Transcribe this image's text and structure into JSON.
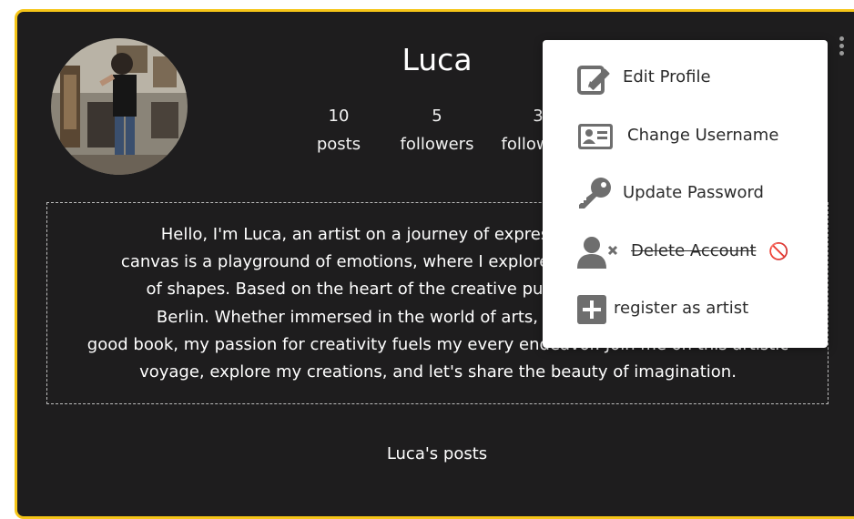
{
  "profile": {
    "name": "Luca",
    "stats": [
      {
        "value": "10",
        "label": "posts"
      },
      {
        "value": "5",
        "label": "followers"
      },
      {
        "value": "3",
        "label": "following"
      }
    ],
    "bio": "Hello, I'm Luca, an artist on a journey of expression through art. My\ncanvas is a playground of emotions, where I explore the beauty of colors and\nof shapes. Based on the heart of the creative pulse, I find inspiration in\nBerlin. Whether immersed in the world of arts, sketching, or lost in a\ngood book, my passion for creativity fuels my every endeavor. Join me on this artistic\nvoyage, explore my creations, and let's share the beauty of imagination.",
    "posts_title": "Luca's posts"
  },
  "menu": {
    "items": [
      {
        "label": "Edit Profile",
        "icon": "edit-icon"
      },
      {
        "label": "Change Username",
        "icon": "id-card-icon"
      },
      {
        "label": "Update Password",
        "icon": "key-icon"
      },
      {
        "label": "Delete Account",
        "icon": "user-remove-icon",
        "suffix": "🚫",
        "disabled": true
      },
      {
        "label": "register as artist",
        "icon": "plus-square-icon"
      }
    ]
  },
  "colors": {
    "card_bg": "#1e1d1e",
    "card_border": "#f5c518",
    "menu_bg": "#ffffff",
    "menu_icon": "#6e6e6e"
  }
}
